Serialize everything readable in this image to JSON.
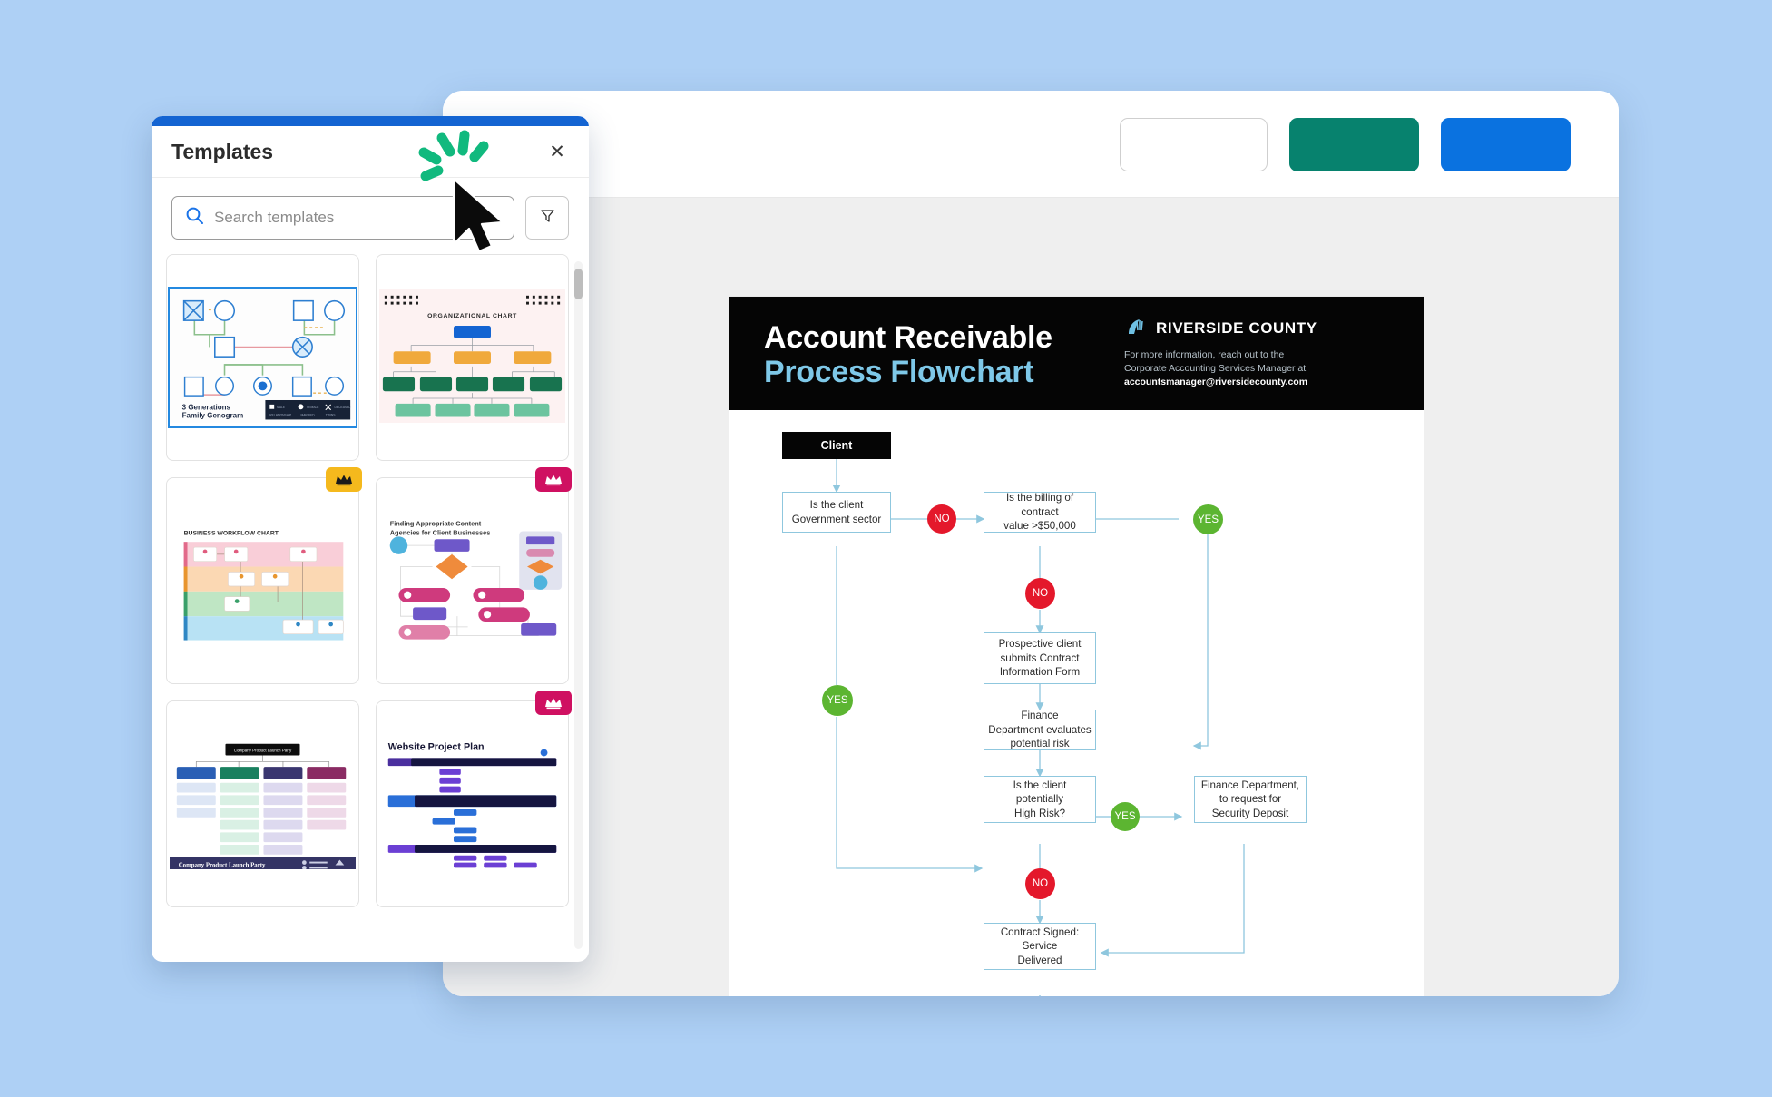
{
  "canvas_background": "#aed0f5",
  "app": {
    "toolbar": {
      "buttons": [
        {
          "name": "toolbar-ghost-button",
          "label": "",
          "color": "#ffffff"
        },
        {
          "name": "toolbar-teal-button",
          "label": "",
          "color": "#07826e"
        },
        {
          "name": "toolbar-blue-button",
          "label": "",
          "color": "#0a72e0"
        }
      ]
    }
  },
  "document": {
    "header": {
      "title_line1": "Account Receivable",
      "title_line2": "Process Flowchart",
      "title_line1_color": "#ffffff",
      "title_line2_color": "#7ec8e8",
      "background": "#050505",
      "brand_name": "RIVERSIDE COUNTY",
      "brand_note_line1": "For more information, reach out to the",
      "brand_note_line2": "Corporate Accounting Services Manager at",
      "brand_email": "accountsmanager@riversidecounty.com"
    },
    "chart_data": {
      "type": "diagram",
      "title": "Account Receivable Process Flowchart",
      "node_border_color": "#8fc7de",
      "yes_color": "#5cb531",
      "no_color": "#e4182b",
      "nodes": [
        {
          "id": "client",
          "label": "Client",
          "shape": "terminator",
          "style": "dark"
        },
        {
          "id": "gov",
          "label": "Is the client\nGovernment sector",
          "shape": "process"
        },
        {
          "id": "billing",
          "label": "Is the billing of contract\nvalue >$50,000",
          "shape": "process"
        },
        {
          "id": "form",
          "label": "Prospective client\nsubmits Contract\nInformation Form",
          "shape": "process"
        },
        {
          "id": "risk_eval",
          "label": "Finance\nDepartment evaluates\npotential risk",
          "shape": "process"
        },
        {
          "id": "highrisk",
          "label": "Is the client\npotentially\nHigh Risk?",
          "shape": "process"
        },
        {
          "id": "deposit",
          "label": "Finance Department,\nto request for\nSecurity Deposit",
          "shape": "process"
        },
        {
          "id": "signed",
          "label": "Contract Signed:\nService\nDelivered",
          "shape": "process"
        }
      ],
      "edge_labels": [
        {
          "id": "no_gov",
          "label": "NO",
          "type": "no",
          "from": "gov",
          "to": "billing"
        },
        {
          "id": "yes_gov",
          "label": "YES",
          "type": "yes",
          "from": "gov",
          "to": "signed"
        },
        {
          "id": "yes_billing",
          "label": "YES",
          "type": "yes",
          "from": "billing",
          "to": "deposit"
        },
        {
          "id": "no_billing",
          "label": "NO",
          "type": "no",
          "from": "billing",
          "to": "form"
        },
        {
          "id": "yes_risk",
          "label": "YES",
          "type": "yes",
          "from": "highrisk",
          "to": "deposit"
        },
        {
          "id": "no_risk",
          "label": "NO",
          "type": "no",
          "from": "highrisk",
          "to": "signed"
        }
      ]
    }
  },
  "templates_panel": {
    "title": "Templates",
    "close_icon": "close-icon",
    "accent_color": "#1464d2",
    "search": {
      "placeholder": "Search templates",
      "value": "",
      "icon": "search-icon"
    },
    "filter_button": {
      "icon": "filter-icon",
      "label": ""
    },
    "cards": [
      {
        "name": "3 Generations Family Genogram",
        "thumb": "genogram",
        "premium": false,
        "crown": null,
        "selected": true
      },
      {
        "name": "Organizational Chart",
        "thumb": "orgchart",
        "premium": false,
        "crown": null,
        "selected": false
      },
      {
        "name": "Business Workflow Chart",
        "thumb": "workflow",
        "premium": true,
        "crown": "gold",
        "selected": false
      },
      {
        "name": "Finding Appropriate Content Agencies for Client Businesses",
        "thumb": "agencies",
        "premium": true,
        "crown": "pink",
        "selected": false
      },
      {
        "name": "Company Product Launch Party",
        "thumb": "launch",
        "premium": false,
        "crown": null,
        "selected": false
      },
      {
        "name": "Website Project Plan",
        "thumb": "projectplan",
        "premium": true,
        "crown": "pink",
        "selected": false
      }
    ],
    "thumb_titles": {
      "genogram_line1": "3 Generations",
      "genogram_line2": "Family Genogram",
      "orgchart": "ORGANIZATIONAL CHART",
      "workflow": "BUSINESS WORKFLOW CHART",
      "agencies_line1": "Finding Appropriate Content",
      "agencies_line2": "Agencies for Client Businesses",
      "launch": "Company Product Launch Party",
      "projectplan": "Website Project Plan"
    },
    "scrollbar": {
      "name": "templates-scrollbar"
    }
  },
  "pointer": {
    "cursor_icon": "mouse-cursor",
    "sparkle_icon": "click-sparkle",
    "sparkle_color": "#11b97e"
  }
}
